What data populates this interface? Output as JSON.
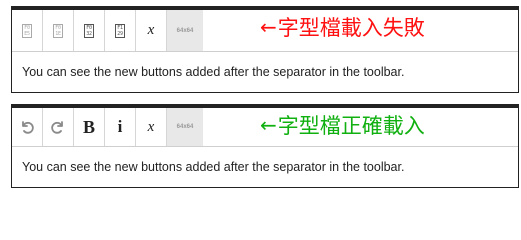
{
  "top_editor": {
    "buttons": [
      {
        "name": "undo-button",
        "glyph_lines": [
          "F0",
          "E5"
        ],
        "style": "light"
      },
      {
        "name": "redo-button",
        "glyph_lines": [
          "F0",
          "1E"
        ],
        "style": "light"
      },
      {
        "name": "bold-button",
        "glyph_lines": [
          "F0",
          "32"
        ],
        "style": "dark"
      },
      {
        "name": "info-button",
        "glyph_lines": [
          "F1",
          "29"
        ],
        "style": "dark"
      }
    ],
    "x_label": "x",
    "base64_label": "64x64",
    "content_text": "You can see the new buttons added after the separator in the toolbar.",
    "annotation": {
      "arrow": "←",
      "text": "字型檔載入失敗",
      "color": "#ff1111"
    }
  },
  "bottom_editor": {
    "x_label": "x",
    "base64_label": "64x64",
    "content_text": "You can see the new buttons added after the separator in the toolbar.",
    "annotation": {
      "arrow": "←",
      "text": "字型檔正確載入",
      "color": "#10b010"
    }
  },
  "icons": {
    "undo": "undo-icon",
    "redo": "redo-icon",
    "bold": "bold-icon",
    "info": "info-icon"
  }
}
